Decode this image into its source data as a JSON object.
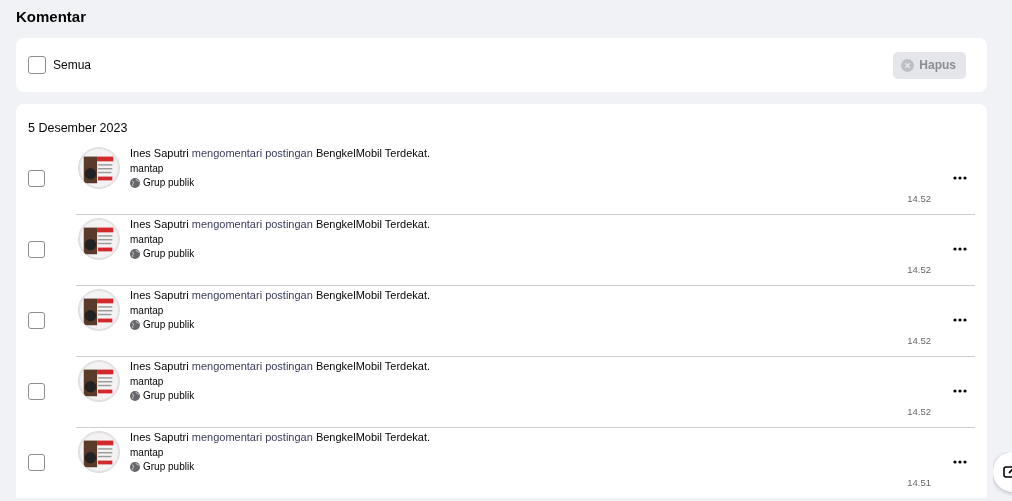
{
  "page_title": "Komentar",
  "toolbar": {
    "select_all": {
      "label": "Semua",
      "checked": false
    },
    "delete_button": {
      "label": "Hapus",
      "disabled": true
    }
  },
  "groups": [
    {
      "date": "5 Desember 2023",
      "items": [
        {
          "actor": "Ines Saputri",
          "action": "mengomentari postingan",
          "target": "BengkelMobil Terdekat.",
          "comment": "mantap",
          "audience": "Grup publik",
          "time": "14.52",
          "checked": false
        },
        {
          "actor": "Ines Saputri",
          "action": "mengomentari postingan",
          "target": "BengkelMobil Terdekat.",
          "comment": "mantap",
          "audience": "Grup publik",
          "time": "14.52",
          "checked": false
        },
        {
          "actor": "Ines Saputri",
          "action": "mengomentari postingan",
          "target": "BengkelMobil Terdekat.",
          "comment": "mantap",
          "audience": "Grup publik",
          "time": "14.52",
          "checked": false
        },
        {
          "actor": "Ines Saputri",
          "action": "mengomentari postingan",
          "target": "BengkelMobil Terdekat.",
          "comment": "mantap",
          "audience": "Grup publik",
          "time": "14.52",
          "checked": false
        },
        {
          "actor": "Ines Saputri",
          "action": "mengomentari postingan",
          "target": "BengkelMobil Terdekat.",
          "comment": "mantap",
          "audience": "Grup publik",
          "time": "14.51",
          "checked": false
        }
      ]
    }
  ]
}
